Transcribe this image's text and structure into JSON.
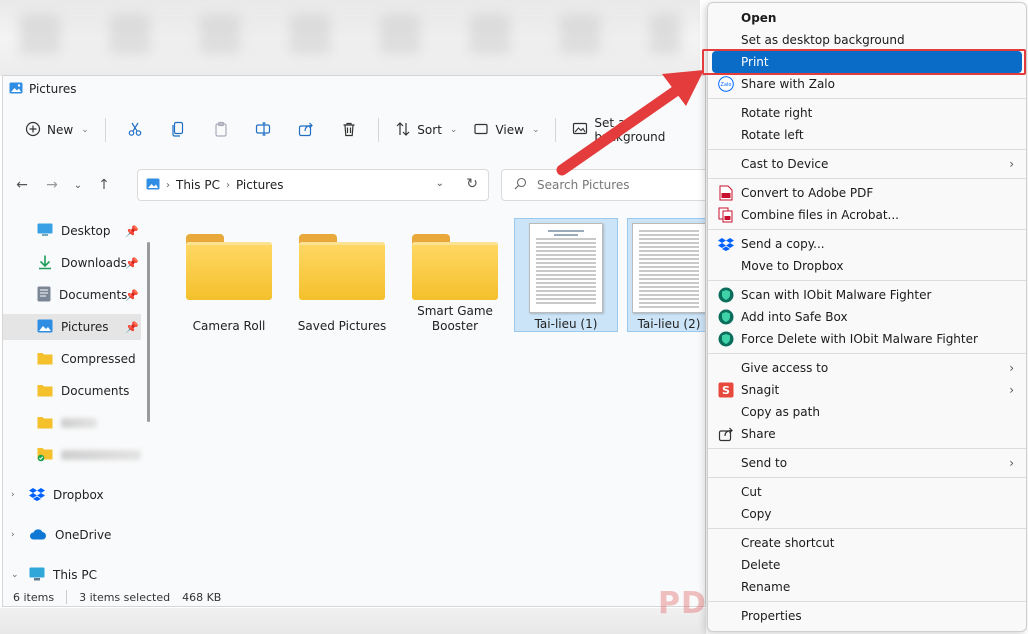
{
  "window": {
    "title": "Pictures"
  },
  "toolbar": {
    "new_label": "New",
    "sort_label": "Sort",
    "view_label": "View",
    "set_background_label": "Set as background"
  },
  "address": {
    "crumbs": [
      "This PC",
      "Pictures"
    ]
  },
  "search": {
    "placeholder": "Search Pictures"
  },
  "sidebar": {
    "items": [
      {
        "label": "Desktop",
        "pinned": true
      },
      {
        "label": "Downloads",
        "pinned": true
      },
      {
        "label": "Documents",
        "pinned": true
      },
      {
        "label": "Pictures",
        "pinned": true,
        "active": true
      },
      {
        "label": "Compressed"
      },
      {
        "label": "Documents"
      }
    ],
    "roots": [
      {
        "label": "Dropbox"
      },
      {
        "label": "OneDrive"
      },
      {
        "label": "This PC"
      }
    ]
  },
  "files": [
    {
      "label": "Camera Roll",
      "type": "folder"
    },
    {
      "label": "Saved Pictures",
      "type": "folder"
    },
    {
      "label": "Smart Game Booster",
      "type": "folder"
    },
    {
      "label": "Tai-lieu (1)",
      "type": "document",
      "selected": true
    },
    {
      "label": "Tai-lieu (2)",
      "type": "document",
      "selected": true
    }
  ],
  "status": {
    "count": "6 items",
    "selected": "3 items selected",
    "size": "468 KB"
  },
  "context_menu": {
    "items": [
      {
        "label": "Open",
        "bold": true
      },
      {
        "label": "Set as desktop background"
      },
      {
        "label": "Print",
        "highlight": true
      },
      {
        "label": "Share with Zalo",
        "icon": "zalo-icon"
      },
      {
        "label": "Rotate right"
      },
      {
        "label": "Rotate left"
      },
      {
        "label": "Cast to Device",
        "submenu": true
      },
      {
        "label": "Convert to Adobe PDF",
        "icon": "adobe-pdf-icon"
      },
      {
        "label": "Combine files in Acrobat...",
        "icon": "acrobat-combine-icon"
      },
      {
        "label": "Send a copy...",
        "icon": "dropbox-icon"
      },
      {
        "label": "Move to Dropbox"
      },
      {
        "label": "Scan with IObit Malware Fighter",
        "icon": "iobit-shield-icon"
      },
      {
        "label": "Add into Safe Box",
        "icon": "iobit-shield-icon"
      },
      {
        "label": "Force Delete with IObit Malware Fighter",
        "icon": "iobit-shield-icon"
      },
      {
        "label": "Give access to",
        "submenu": true
      },
      {
        "label": "Snagit",
        "icon": "snagit-icon",
        "submenu": true
      },
      {
        "label": "Copy as path"
      },
      {
        "label": "Share",
        "icon": "share-icon"
      },
      {
        "label": "Send to",
        "submenu": true
      },
      {
        "label": "Cut"
      },
      {
        "label": "Copy"
      },
      {
        "label": "Create shortcut"
      },
      {
        "label": "Delete"
      },
      {
        "label": "Rename"
      },
      {
        "label": "Properties"
      }
    ]
  },
  "watermark": "PDF.vn",
  "colors": {
    "highlight": "#0a6cc7",
    "annotation": "#e43c3c",
    "folder": "#f4c02c",
    "selection": "#cce4f7"
  }
}
